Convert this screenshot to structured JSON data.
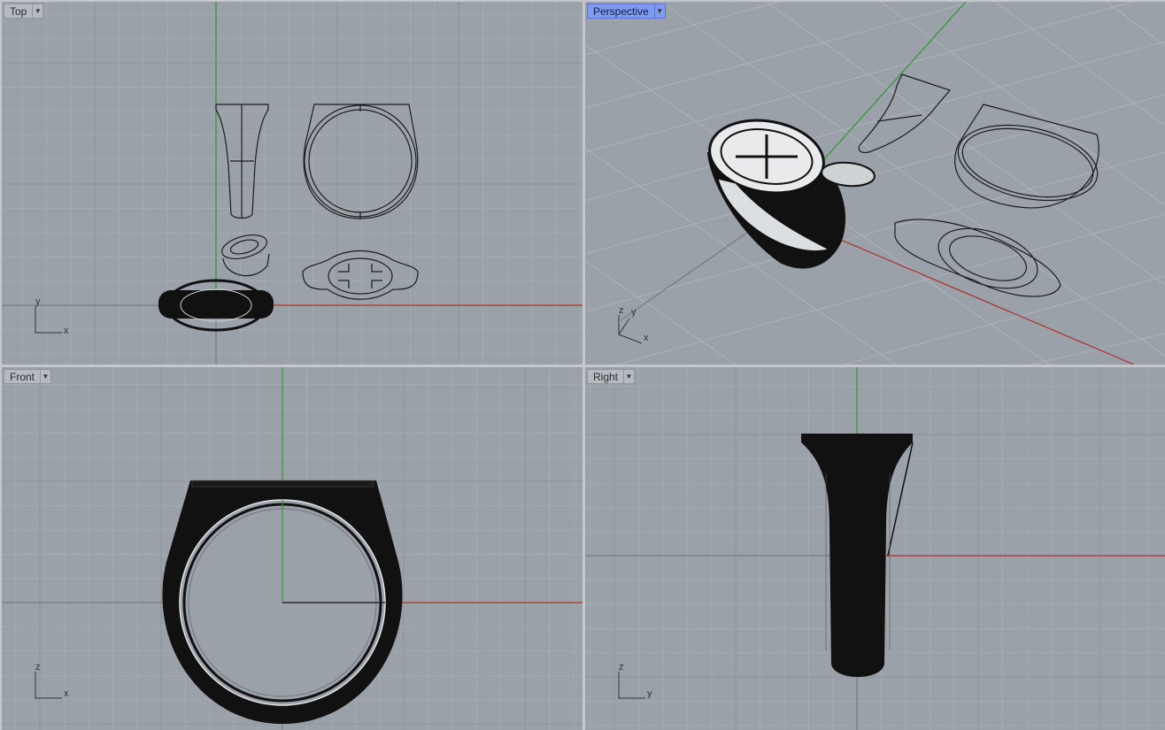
{
  "viewports": {
    "top": {
      "title": "Top",
      "axis_a": "y",
      "axis_b": "x"
    },
    "perspective": {
      "title": "Perspective",
      "axis_a": "z",
      "axis_b": "y",
      "axis_c": "x"
    },
    "front": {
      "title": "Front",
      "axis_a": "z",
      "axis_b": "x"
    },
    "right": {
      "title": "Right",
      "axis_a": "z",
      "axis_b": "y"
    }
  },
  "colors": {
    "viewport_bg": "#9ba1a8",
    "grid_minor": "#aeb3b9",
    "grid_major": "#8e949a",
    "x_axis": "#b03030",
    "y_axis": "#2e9a2e",
    "active_title": "#7f9bf0"
  },
  "icons": {
    "dropdown": "chevron-down-icon"
  }
}
